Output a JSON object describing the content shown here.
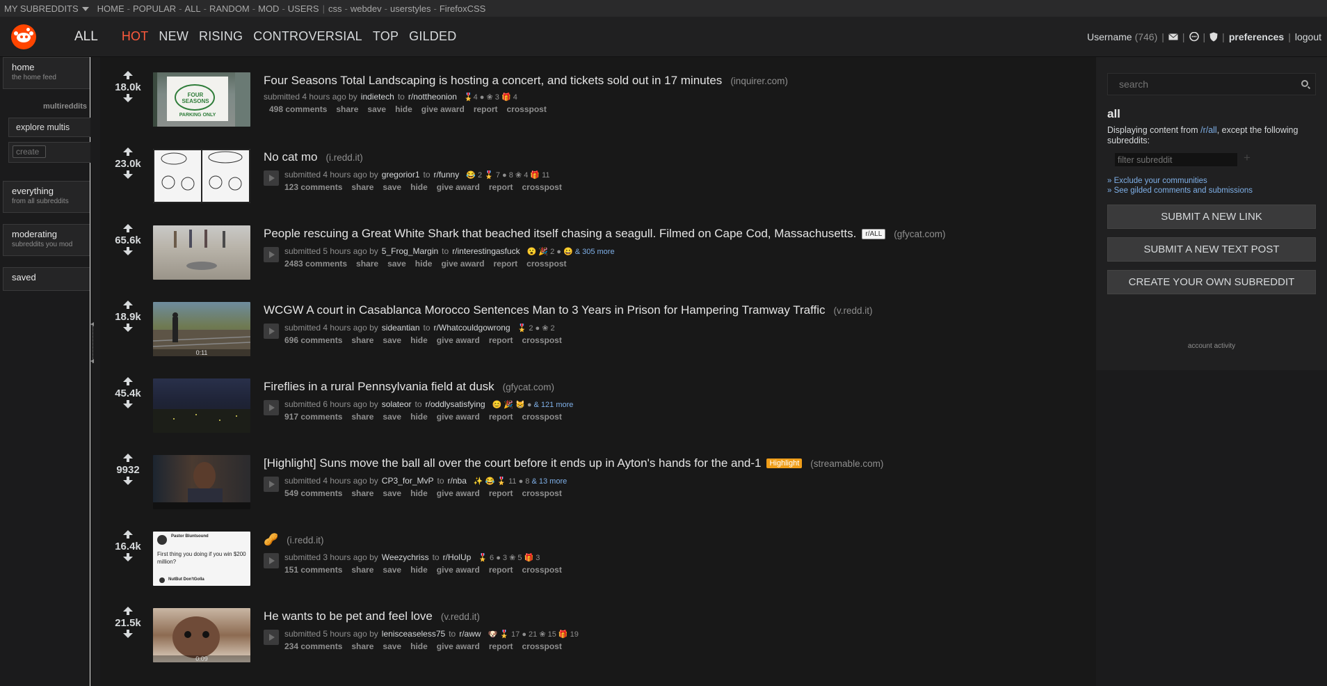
{
  "topstrip": {
    "my_subreddits": "MY SUBREDDITS",
    "links": [
      "HOME",
      "POPULAR",
      "ALL",
      "RANDOM",
      "MOD",
      "USERS"
    ],
    "subs": [
      "css",
      "webdev",
      "userstyles",
      "FirefoxCSS"
    ]
  },
  "header": {
    "subreddit": "ALL",
    "tabs": [
      "HOT",
      "NEW",
      "RISING",
      "CONTROVERSIAL",
      "TOP",
      "GILDED"
    ],
    "selected_tab": "HOT",
    "username": "Username",
    "karma": "(746)",
    "preferences": "preferences",
    "logout": "logout"
  },
  "leftbar": {
    "home": {
      "title": "home",
      "sub": "the home feed"
    },
    "multireddits": "multireddits",
    "explore": "explore multis",
    "create_placeholder": "create",
    "everything": {
      "title": "everything",
      "sub": "from all subreddits"
    },
    "moderating": {
      "title": "moderating",
      "sub": "subreddits you mod"
    },
    "saved": {
      "title": "saved"
    }
  },
  "posts": [
    {
      "score": "18.0k",
      "title": "Four Seasons Total Landscaping is hosting a concert, and tickets sold out in 17 minutes",
      "domain": "(inquirer.com)",
      "time": "4 hours ago",
      "author": "indietech",
      "sub": "r/nottheonion",
      "awards": "🎖️4 ● ❀ 3 🎁 4",
      "more": "",
      "comments": "498 comments",
      "flair": "",
      "duration": ""
    },
    {
      "score": "23.0k",
      "title": "No cat mo",
      "domain": "(i.redd.it)",
      "time": "4 hours ago",
      "author": "gregorior1",
      "sub": "r/funny",
      "awards": "😂 2 🎖️ 7 ● 8 ❀ 4 🎁 11",
      "more": "",
      "comments": "123 comments",
      "flair": "",
      "duration": ""
    },
    {
      "score": "65.6k",
      "title": "People rescuing a Great White Shark that beached itself chasing a seagull. Filmed on Cape Cod, Massachusetts.",
      "domain": "(gfycat.com)",
      "time": "5 hours ago",
      "author": "5_Frog_Margin",
      "sub": "r/interestingasfuck",
      "awards": "😮 🎉 2 ● 😀",
      "more": "& 305 more",
      "comments": "2483 comments",
      "flair": "r/ALL",
      "duration": ""
    },
    {
      "score": "18.9k",
      "title": "WCGW A court in Casablanca Morocco Sentences Man to 3 Years in Prison for Hampering Tramway Traffic",
      "domain": "(v.redd.it)",
      "time": "4 hours ago",
      "author": "sideantian",
      "sub": "r/Whatcouldgowrong",
      "awards": "🎖️ 2 ● ❀ 2",
      "more": "",
      "comments": "696 comments",
      "flair": "",
      "duration": "0:11"
    },
    {
      "score": "45.4k",
      "title": "Fireflies in a rural Pennsylvania field at dusk",
      "domain": "(gfycat.com)",
      "time": "6 hours ago",
      "author": "solateor",
      "sub": "r/oddlysatisfying",
      "awards": "😊 🎉 😸 ●",
      "more": "& 121 more",
      "comments": "917 comments",
      "flair": "",
      "duration": ""
    },
    {
      "score": "9932",
      "title": "[Highlight] Suns move the ball all over the court before it ends up in Ayton's hands for the and-1",
      "domain": "(streamable.com)",
      "time": "4 hours ago",
      "author": "CP3_for_MvP",
      "sub": "r/nba",
      "awards": "✨ 😂 🎖️ 11 ● 8",
      "more": "& 13 more",
      "comments": "549 comments",
      "flair": "Highlight",
      "duration": ""
    },
    {
      "score": "16.4k",
      "title": "🥜",
      "domain": "(i.redd.it)",
      "time": "3 hours ago",
      "author": "Weezychriss",
      "sub": "r/HolUp",
      "awards": "🎖️ 6 ● 3 ❀ 5 🎁 3",
      "more": "",
      "comments": "151 comments",
      "flair": "",
      "duration": ""
    },
    {
      "score": "21.5k",
      "title": "He wants to be pet and feel love",
      "domain": "(v.redd.it)",
      "time": "5 hours ago",
      "author": "lenisceaseless75",
      "sub": "r/aww",
      "awards": "🐶 🎖️ 17 ● 21 ❀ 15 🎁 19",
      "more": "",
      "comments": "234 comments",
      "flair": "",
      "duration": "0:09"
    }
  ],
  "post_labels": {
    "submitted": "submitted",
    "by": "by",
    "to": "to",
    "share": "share",
    "save": "save",
    "hide": "hide",
    "give_award": "give award",
    "report": "report",
    "crosspost": "crosspost"
  },
  "thumb_text": {
    "t1_sign": "FOUR SEASONS",
    "t1_sub": "PARKING ONLY",
    "t7_name": "Pastor Bluntsound",
    "t7_text": "First thing you doing if you win $200 million?",
    "t7_reply": "NutBut Don'tGolla"
  },
  "sidebar": {
    "search_placeholder": "search",
    "heading": "all",
    "desc_pre": "Displaying content from ",
    "desc_link": "/r/all",
    "desc_post": ", except the following subreddits:",
    "filter_placeholder": "filter subreddit",
    "plus": "+",
    "exclude": "» Exclude your communities",
    "gilded": "» See gilded comments and submissions",
    "submit_link": "SUBMIT A NEW LINK",
    "submit_text": "SUBMIT A NEW TEXT POST",
    "create_sub": "CREATE YOUR OWN SUBREDDIT",
    "account_activity": "account activity"
  }
}
